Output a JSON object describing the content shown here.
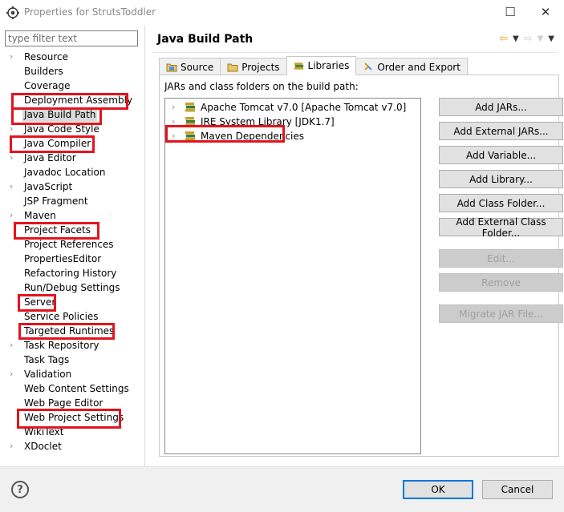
{
  "window": {
    "title": "Properties for StrutsToddler",
    "minimize": "—",
    "maximize": "☐",
    "close": "✕"
  },
  "filter": {
    "placeholder": "type filter text"
  },
  "tree": [
    {
      "label": "Resource",
      "expandable": true
    },
    {
      "label": "Builders",
      "expandable": false
    },
    {
      "label": "Coverage",
      "expandable": false
    },
    {
      "label": "Deployment Assembly",
      "expandable": false
    },
    {
      "label": "Java Build Path",
      "expandable": false,
      "selected": true
    },
    {
      "label": "Java Code Style",
      "expandable": true
    },
    {
      "label": "Java Compiler",
      "expandable": true
    },
    {
      "label": "Java Editor",
      "expandable": true
    },
    {
      "label": "Javadoc Location",
      "expandable": false
    },
    {
      "label": "JavaScript",
      "expandable": true
    },
    {
      "label": "JSP Fragment",
      "expandable": false
    },
    {
      "label": "Maven",
      "expandable": true
    },
    {
      "label": "Project Facets",
      "expandable": false
    },
    {
      "label": "Project References",
      "expandable": false
    },
    {
      "label": "PropertiesEditor",
      "expandable": false
    },
    {
      "label": "Refactoring History",
      "expandable": false
    },
    {
      "label": "Run/Debug Settings",
      "expandable": false
    },
    {
      "label": "Server",
      "expandable": false
    },
    {
      "label": "Service Policies",
      "expandable": false
    },
    {
      "label": "Targeted Runtimes",
      "expandable": false
    },
    {
      "label": "Task Repository",
      "expandable": true
    },
    {
      "label": "Task Tags",
      "expandable": false
    },
    {
      "label": "Validation",
      "expandable": true
    },
    {
      "label": "Web Content Settings",
      "expandable": false
    },
    {
      "label": "Web Page Editor",
      "expandable": false
    },
    {
      "label": "Web Project Settings",
      "expandable": false
    },
    {
      "label": "WikiText",
      "expandable": false
    },
    {
      "label": "XDoclet",
      "expandable": true
    }
  ],
  "page": {
    "title": "Java Build Path"
  },
  "tabs": [
    "Source",
    "Projects",
    "Libraries",
    "Order and Export"
  ],
  "active_tab": "Libraries",
  "libraries": {
    "caption": "JARs and class folders on the build path:",
    "items": [
      "Apache Tomcat v7.0 [Apache Tomcat v7.0]",
      "JRE System Library [JDK1.7]",
      "Maven Dependencies"
    ]
  },
  "buttons": {
    "add_jars": "Add JARs...",
    "add_external_jars": "Add External JARs...",
    "add_variable": "Add Variable...",
    "add_library": "Add Library...",
    "add_class_folder": "Add Class Folder...",
    "add_external_class_folder": "Add External Class Folder...",
    "edit": "Edit...",
    "remove": "Remove",
    "migrate_jar": "Migrate JAR File..."
  },
  "footer": {
    "help": "?",
    "ok": "OK",
    "cancel": "Cancel"
  },
  "colors": {
    "highlight": "#e3141e",
    "accent": "#0078d7"
  }
}
